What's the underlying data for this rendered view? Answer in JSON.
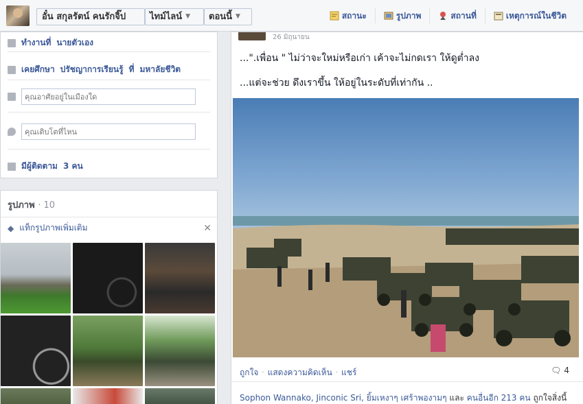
{
  "header": {
    "profile_name": "อั๋น สกุลรัตน์ คนรักจิ๊ป",
    "timeline_label": "ไทม์ไลน์",
    "now_label": "ตอนนี้",
    "actions": [
      {
        "label": "สถานะ",
        "icon": "status-icon"
      },
      {
        "label": "รูปภาพ",
        "icon": "photo-icon"
      },
      {
        "label": "สถานที่",
        "icon": "place-icon"
      },
      {
        "label": "เหตุการณ์ในชีวิต",
        "icon": "life-event-icon"
      }
    ]
  },
  "about": {
    "work_prefix": "ทำงานที่",
    "work_value": "นายตัวเอง",
    "study_prefix": "เคยศึกษา",
    "study_mid": "ปรัชญาการเรียนรู้",
    "study_at": "ที่",
    "study_value": "มหาลัยชีวิต",
    "city_placeholder": "คุณอาศัยอยู่ในเมืองใด",
    "hometown_placeholder": "คุณเติบโตที่ไหน",
    "followers_prefix": "มีผู้ติดตาม",
    "followers_count": "3 คน"
  },
  "photos": {
    "title": "รูปภาพ",
    "count": "10",
    "tag_label": "แท็กรูปภาพเพิ่มเติม"
  },
  "post": {
    "date_fragment": "26 มิถุนายน",
    "line1": "...\".เพื่อน \" ไม่ว่าจะใหม่หรือเก่า เค้าจะไม่กดเรา ให้ดูต่ำลง",
    "line2": "...แต่จะช่วย ดึงเราขึ้น ให้อยู่ในระดับที่เท่ากัน ..",
    "like": "ถูกใจ",
    "comment": "แสดงความคิดเห็น",
    "share": "แชร์",
    "comment_count": "4",
    "likes_names": "Sophon Wannako, Jinconic Sri, ยิ้มเหงาๆ เศร้าพองามๆ",
    "likes_and": "และ",
    "likes_others": "คนอื่นอีก 213 คน",
    "likes_tail": "ถูกใจสิ่งนี้"
  }
}
